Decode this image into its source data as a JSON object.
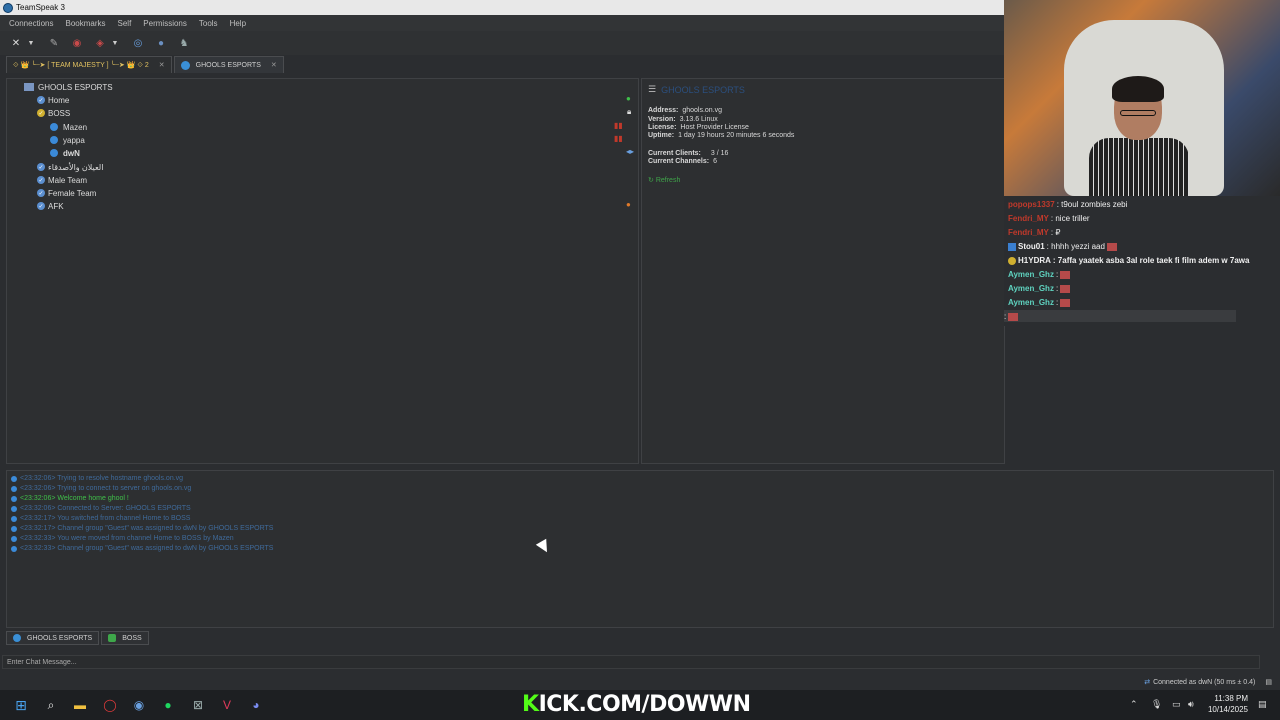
{
  "window": {
    "title": "TeamSpeak 3"
  },
  "menu": [
    "Connections",
    "Bookmarks",
    "Self",
    "Permissions",
    "Tools",
    "Help"
  ],
  "tabs": [
    {
      "label": "⟐ 👑 ╰┈➤ [ TEAM MAJESTY ] ╰┈➤ 👑 ⟐ 2"
    },
    {
      "label": "GHOOLS ESPORTS"
    }
  ],
  "tree": {
    "server": "GHOOLS ESPORTS",
    "channels": [
      {
        "name": "Home"
      },
      {
        "name": "BOSS"
      },
      {
        "name": "العيلان والأصدقاء"
      },
      {
        "name": "Male Team"
      },
      {
        "name": "Female Team"
      },
      {
        "name": "AFK"
      }
    ],
    "clients": [
      "Mazen",
      "yappa",
      "dwN"
    ]
  },
  "info": {
    "server_name": "GHOOLS ESPORTS",
    "address_label": "Address:",
    "address": "ghools.on.vg",
    "version_label": "Version:",
    "version": "3.13.6 Linux",
    "license_label": "License:",
    "license": "Host Provider License",
    "uptime_label": "Uptime:",
    "uptime": "1 day 19 hours 20 minutes 6 seconds",
    "clients_label": "Current Clients:",
    "clients": "3 / 16",
    "channels_label": "Current Channels:",
    "channels": "6",
    "refresh": "Refresh"
  },
  "stream_chat": [
    {
      "user": "popops1337",
      "text": ": t9oul zombies zebi",
      "color": "#c0392b"
    },
    {
      "user": "Fendri_MY",
      "text": ": nice triller",
      "color": "#c0392b"
    },
    {
      "user": "Fendri_MY",
      "text": ": ₽",
      "color": "#c0392b"
    },
    {
      "user": "Stou01",
      "text": ": hhhh yezzi aad",
      "color": "#f0f0f0"
    },
    {
      "user": "H1YDRA",
      "text": ": 7affa yaatek asba 3al role taek fi film adem w 7awa",
      "color": "#f0f0f0"
    },
    {
      "user": "Aymen_Ghz",
      "text": ":",
      "color": "#5fd3c0"
    },
    {
      "user": "Aymen_Ghz",
      "text": ":",
      "color": "#5fd3c0"
    },
    {
      "user": "Aymen_Ghz",
      "text": ":",
      "color": "#5fd3c0"
    },
    {
      "user": "",
      "text": ":",
      "color": "#f0f0f0"
    }
  ],
  "log": [
    {
      "text": "<23:32:06> Trying to resolve hostname ghools.on.vg",
      "color": "#3f6a9a"
    },
    {
      "text": "<23:32:06> Trying to connect to server on ghools.on.vg",
      "color": "#3f6a9a"
    },
    {
      "text": "<23:32:06> Welcome home ghool !",
      "color": "#3fbf4a"
    },
    {
      "text": "<23:32:06> Connected to Server: GHOOLS ESPORTS",
      "color": "#3f6a9a"
    },
    {
      "text": "<23:32:17> You switched from channel Home to BOSS",
      "color": "#3f6a9a"
    },
    {
      "text": "<23:32:17> Channel group \"Guest\" was assigned to dwN by GHOOLS ESPORTS",
      "color": "#3f6a9a"
    },
    {
      "text": "<23:32:33> You were moved from channel Home to BOSS by Mazen",
      "color": "#3f6a9a"
    },
    {
      "text": "<23:32:33> Channel group \"Guest\" was assigned to dwN by GHOOLS ESPORTS",
      "color": "#3f6a9a"
    }
  ],
  "bottom_tabs": [
    "GHOOLS ESPORTS",
    "BOSS"
  ],
  "chat_input": {
    "placeholder": "Enter Chat Message..."
  },
  "status": "Connected as dwN (50 ms ± 0.4)",
  "overlay": {
    "kick_first": "K",
    "kick_rest": "ICK.COM/DOWWN"
  },
  "clock": {
    "time": "11:38 PM",
    "date": "10/14/2025"
  }
}
